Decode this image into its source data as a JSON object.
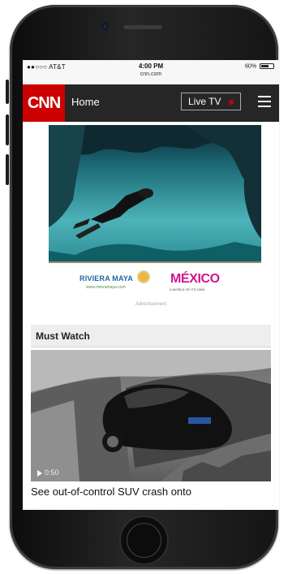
{
  "status_bar": {
    "carrier": "●●○○○ AT&T",
    "time": "4:00 PM",
    "url": "cnn.com",
    "battery": "60%"
  },
  "nav": {
    "logo": "CNN",
    "home_label": "Home",
    "live_tv_label": "Live TV"
  },
  "ad": {
    "riviera_maya": "RIVIERA MAYA",
    "riviera_subtext": "www.rivieramaya.com",
    "mexico": "MÉXICO",
    "mexico_subtext": "A WORLD OF ITS OWN",
    "label": "Advertisement"
  },
  "must_watch": {
    "title": "Must Watch",
    "duration": "0:50",
    "headline": "See out-of-control SUV crash onto"
  }
}
